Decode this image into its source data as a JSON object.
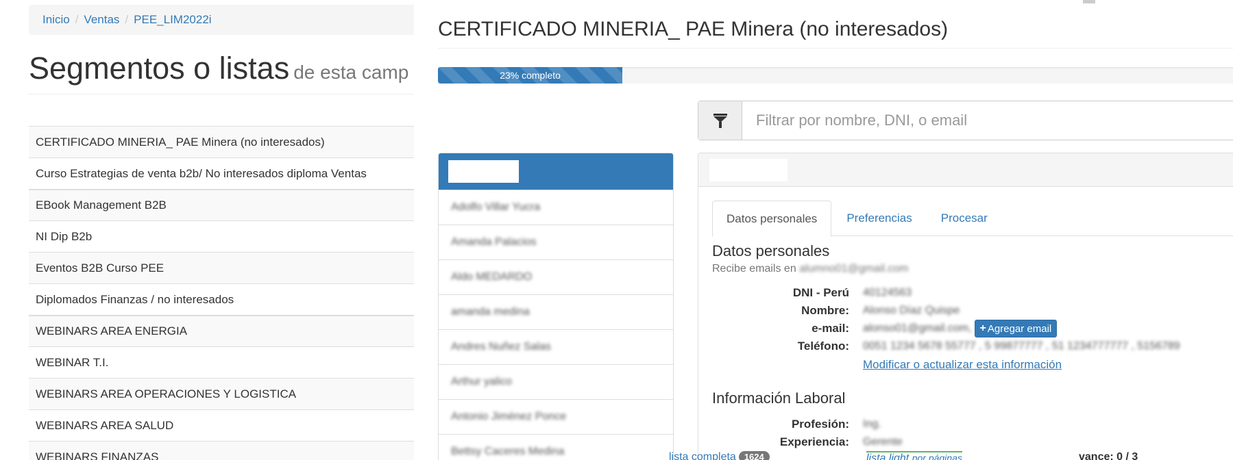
{
  "breadcrumb": {
    "items": [
      "Inicio",
      "Ventas",
      "PEE_LIM2022i"
    ]
  },
  "segments": {
    "title": "Segmentos o listas",
    "subtitle": "de esta camp",
    "items": [
      "CERTIFICADO MINERIA_ PAE Minera (no interesados)",
      "Curso Estrategias de venta b2b/ No interesados diploma Ventas",
      "EBook Management B2B",
      "NI Dip B2b",
      "Eventos B2B Curso PEE",
      "Diplomados Finanzas / no interesados",
      "WEBINARS AREA ENERGIA",
      "WEBINAR T.I.",
      "WEBINARS AREA OPERACIONES Y LOGISTICA",
      "WEBINARS AREA SALUD",
      "WEBINARS FINANZAS"
    ]
  },
  "campaign": {
    "title": "CERTIFICADO MINERIA_ PAE Minera (no interesados)",
    "progress_label": "23% completo",
    "progress": 0.23
  },
  "filter": {
    "placeholder": "Filtrar por nombre, DNI, o email"
  },
  "contacts": {
    "items": [
      "Adolfo Villar Yucra",
      "Amanda Palacios",
      "Aldo MEDARDO",
      "amanda medina",
      "Andres Nuñez Salas",
      "Arthur yalico",
      "Antonio Jiménez Ponce",
      "Bettsy Caceres Medina"
    ]
  },
  "detail": {
    "tabs": [
      "Datos personales",
      "Preferencias",
      "Procesar"
    ],
    "personal_title": "Datos personales",
    "receives_label": "Recibe emails en",
    "receives_value": "alumno01@gmail.com",
    "fields": {
      "dni_label": "DNI - Perú",
      "dni_value": "40124563",
      "name_label": "Nombre:",
      "name_value": "Alonso Díaz Quispe",
      "email_label": "e-mail:",
      "email_value": "alonso01@gmail.com,",
      "phone_label": "Teléfono:",
      "phone_value": "0051 1234 5678 55777 , 5 99877777 , 51 1234777777 , 5156789"
    },
    "add_email_label": "Agregar email",
    "modify_link": "Modificar o actualizar esta información",
    "labor_title": "Información Laboral",
    "profession_label": "Profesión:",
    "profession_value": "Ing.",
    "experience_label": "Experiencia:",
    "experience_value": "Gerente"
  },
  "footer": {
    "full_list_label": "lista completa",
    "full_list_count": "1624",
    "light_list_label": "lista light",
    "light_list_sub": "por páginas",
    "advance_label": "vance: 0 / 3"
  },
  "colors": {
    "primary": "#337ab7",
    "success": "#5cb85c",
    "muted": "#777777"
  }
}
